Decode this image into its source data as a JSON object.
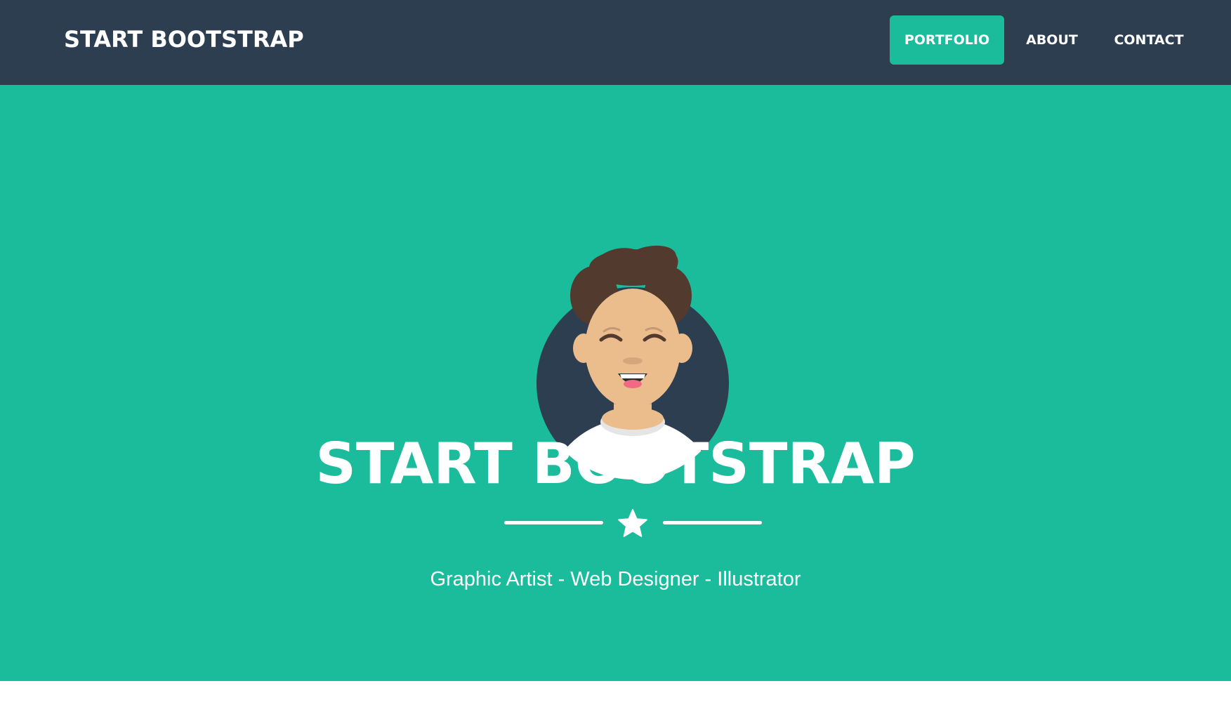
{
  "navbar": {
    "brand": "START BOOTSTRAP",
    "links": [
      {
        "label": "PORTFOLIO",
        "active": true
      },
      {
        "label": "ABOUT",
        "active": false
      },
      {
        "label": "CONTACT",
        "active": false
      }
    ]
  },
  "masthead": {
    "heading": "START BOOTSTRAP",
    "subheading": "Graphic Artist - Web Designer - Illustrator",
    "avatar_icon": "avatar-illustration",
    "divider_icon": "star-icon"
  },
  "colors": {
    "navbar_bg": "#2c3e50",
    "accent": "#1abc9c",
    "text": "#ffffff"
  }
}
